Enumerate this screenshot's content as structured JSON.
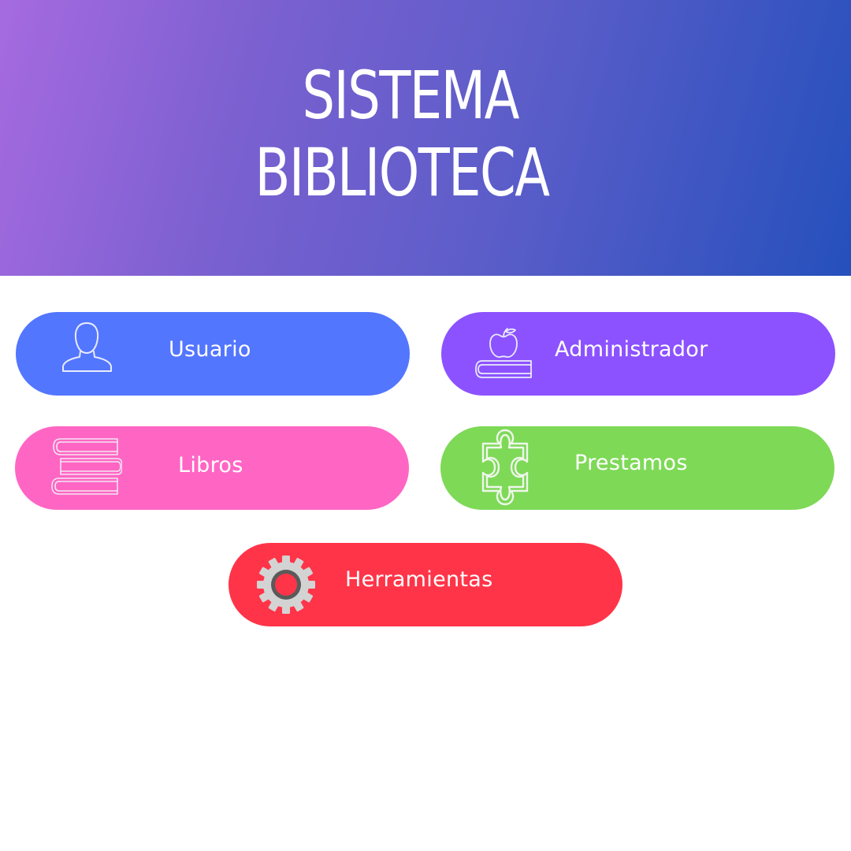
{
  "header": {
    "title_line1": "SISTEMA",
    "title_line2": "BIBLIOTECA",
    "gradient_start": "#a66ae0",
    "gradient_end": "#2550bc"
  },
  "menu": {
    "usuario": {
      "label": "Usuario",
      "icon": "user-icon",
      "color": "#5376ff"
    },
    "administrador": {
      "label": "Administrador",
      "icon": "apple-on-book-icon",
      "color": "#8c52ff"
    },
    "libros": {
      "label": "Libros",
      "icon": "book-stack-icon",
      "color": "#ff66c4"
    },
    "prestamos": {
      "label": "Prestamos",
      "icon": "puzzle-piece-icon",
      "color": "#7ed957"
    },
    "herramientas": {
      "label": "Herramientas",
      "icon": "gear-icon",
      "color": "#ff3448"
    }
  }
}
